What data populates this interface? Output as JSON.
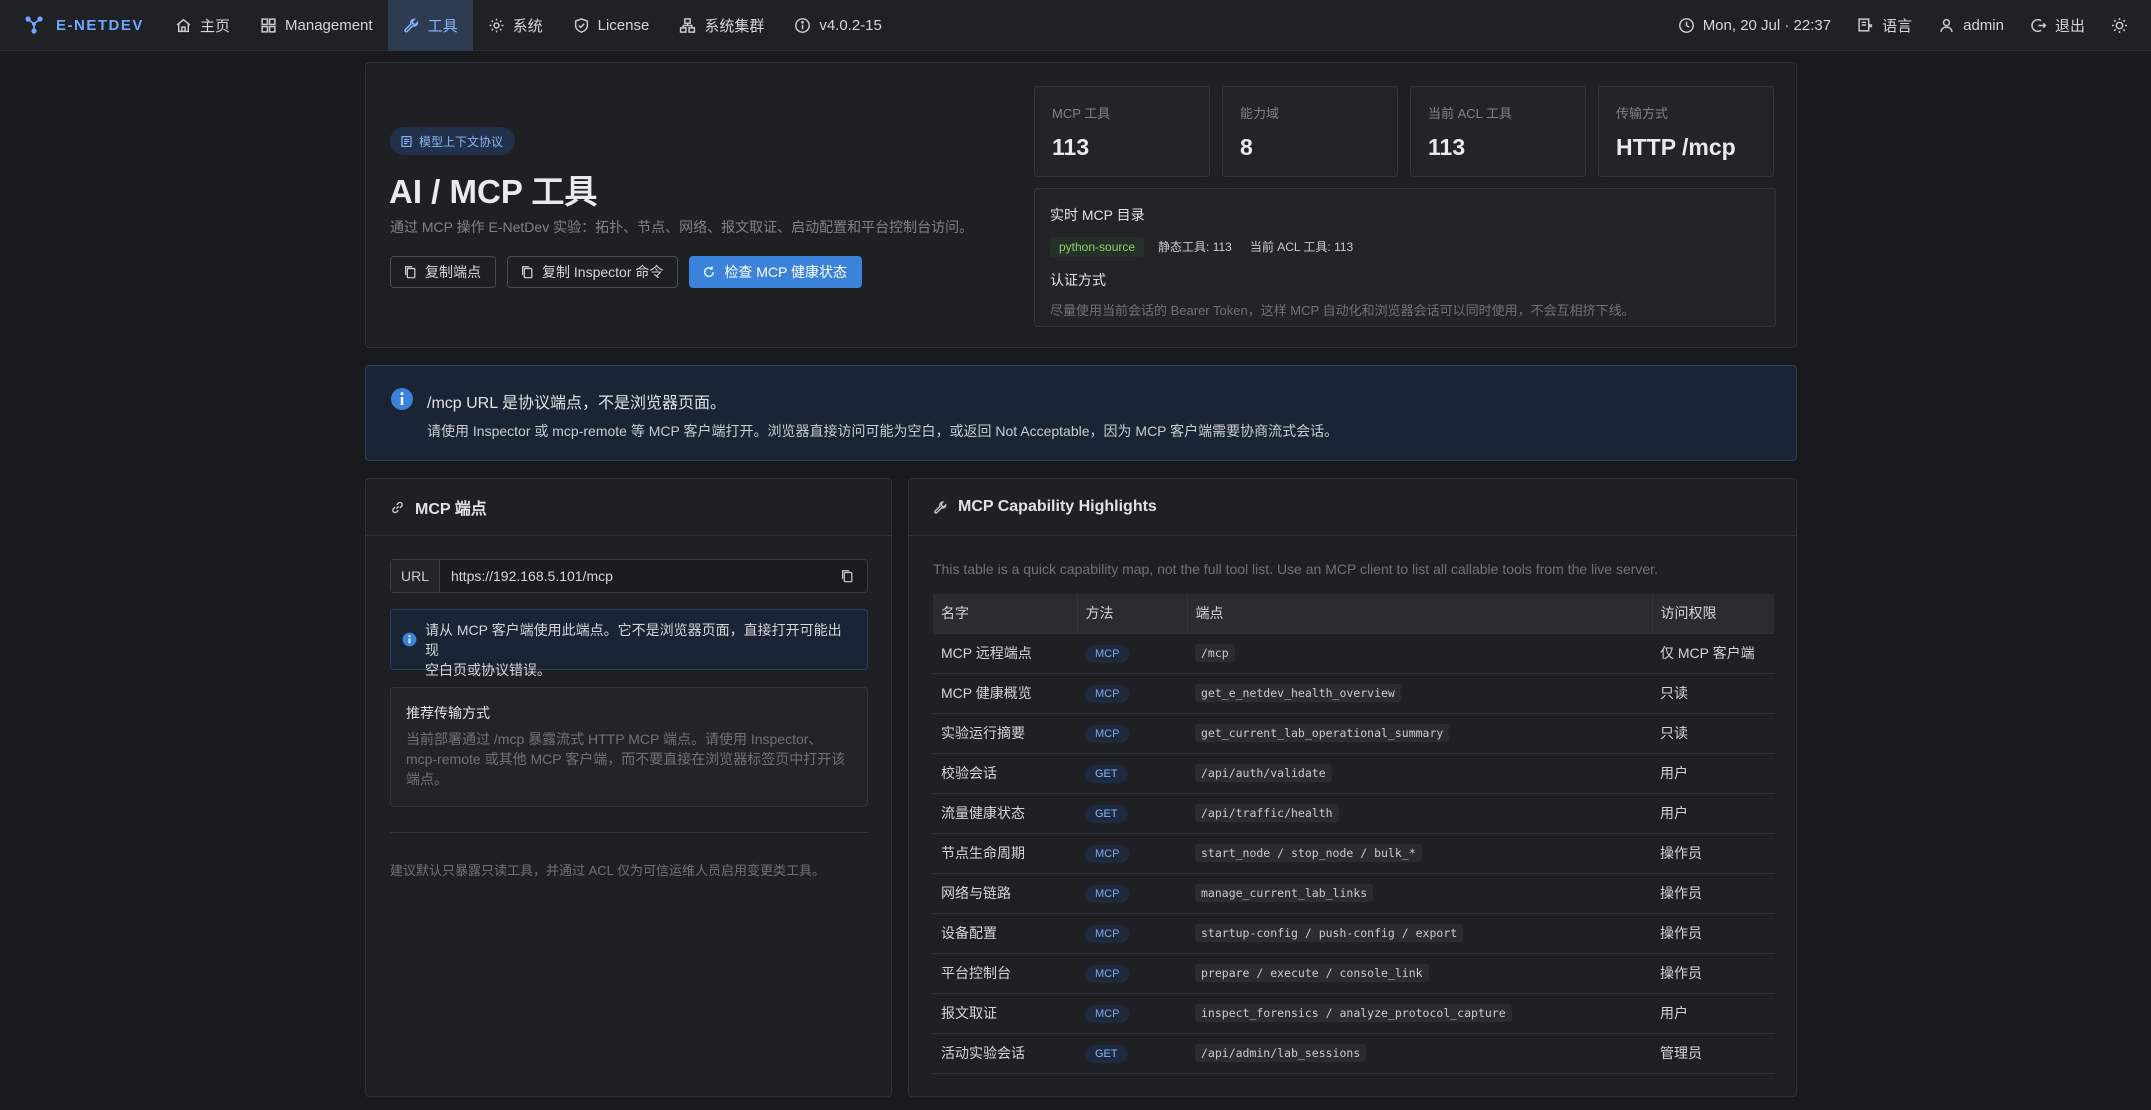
{
  "brand": "E-NETDEV",
  "nav": [
    {
      "label": "主页",
      "icon": "home-icon"
    },
    {
      "label": "Management",
      "icon": "grid-icon"
    },
    {
      "label": "工具",
      "icon": "wrench-icon",
      "active": true
    },
    {
      "label": "系统",
      "icon": "gear-icon"
    },
    {
      "label": "License",
      "icon": "shield-icon"
    },
    {
      "label": "系统集群",
      "icon": "cluster-icon"
    },
    {
      "label": "v4.0.2-15",
      "icon": "info-icon"
    }
  ],
  "nav_right": {
    "datetime": "Mon, 20 Jul · 22:37",
    "language": "语言",
    "user": "admin",
    "logout": "退出"
  },
  "hero": {
    "pill": "模型上下文协议",
    "title": "AI / MCP 工具",
    "subtitle": "通过 MCP 操作 E-NetDev 实验：拓扑、节点、网络、报文取证、启动配置和平台控制台访问。",
    "buttons": {
      "copy_endpoint": "复制端点",
      "copy_inspector": "复制 Inspector 命令",
      "check_health": "检查 MCP 健康状态"
    },
    "stats": [
      {
        "label": "MCP 工具",
        "value": "113"
      },
      {
        "label": "能力域",
        "value": "8"
      },
      {
        "label": "当前 ACL 工具",
        "value": "113"
      },
      {
        "label": "传输方式",
        "value": "HTTP /mcp"
      }
    ],
    "catalog": {
      "title": "实时 MCP 目录",
      "source_tag": "python-source",
      "static_tools": "静态工具: 113",
      "acl_tools": "当前 ACL 工具: 113",
      "auth_title": "认证方式",
      "auth_desc": "尽量使用当前会话的 Bearer Token，这样 MCP 自动化和浏览器会话可以同时使用，不会互相挤下线。"
    }
  },
  "banner": {
    "title": "/mcp URL 是协议端点，不是浏览器页面。",
    "text": "请使用 Inspector 或 mcp-remote 等 MCP 客户端打开。浏览器直接访问可能为空白，或返回 Not Acceptable，因为 MCP 客户端需要协商流式会话。"
  },
  "endpoint_panel": {
    "title": "MCP 端点",
    "url_label": "URL",
    "url_value": "https://192.168.5.101/mcp",
    "alert_line1": "请从 MCP 客户端使用此端点。它不是浏览器页面，直接打开可能出现",
    "alert_line2": "空白页或协议错误。",
    "rec_title": "推荐传输方式",
    "rec_line1": "当前部署通过 /mcp 暴露流式 HTTP MCP 端点。请使用 Inspector、",
    "rec_line2": "mcp-remote 或其他 MCP 客户端，而不要直接在浏览器标签页中打开该",
    "rec_line3": "端点。",
    "note": "建议默认只暴露只读工具，并通过 ACL 仅为可信运维人员启用变更类工具。"
  },
  "capability_panel": {
    "title": "MCP Capability Highlights",
    "description": "This table is a quick capability map, not the full tool list. Use an MCP client to list all callable tools from the live server.",
    "headers": [
      "名字",
      "方法",
      "端点",
      "访问权限"
    ],
    "rows": [
      {
        "name": "MCP 远程端点",
        "method": "MCP",
        "endpoint": "/mcp",
        "access": "仅 MCP 客户端"
      },
      {
        "name": "MCP 健康概览",
        "method": "MCP",
        "endpoint": "get_e_netdev_health_overview",
        "access": "只读"
      },
      {
        "name": "实验运行摘要",
        "method": "MCP",
        "endpoint": "get_current_lab_operational_summary",
        "access": "只读"
      },
      {
        "name": "校验会话",
        "method": "GET",
        "endpoint": "/api/auth/validate",
        "access": "用户"
      },
      {
        "name": "流量健康状态",
        "method": "GET",
        "endpoint": "/api/traffic/health",
        "access": "用户"
      },
      {
        "name": "节点生命周期",
        "method": "MCP",
        "endpoint": "start_node / stop_node / bulk_*",
        "access": "操作员"
      },
      {
        "name": "网络与链路",
        "method": "MCP",
        "endpoint": "manage_current_lab_links",
        "access": "操作员"
      },
      {
        "name": "设备配置",
        "method": "MCP",
        "endpoint": "startup-config / push-config / export",
        "access": "操作员"
      },
      {
        "name": "平台控制台",
        "method": "MCP",
        "endpoint": "prepare / execute / console_link",
        "access": "操作员"
      },
      {
        "name": "报文取证",
        "method": "MCP",
        "endpoint": "inspect_forensics / analyze_protocol_capture",
        "access": "用户"
      },
      {
        "name": "活动实验会话",
        "method": "GET",
        "endpoint": "/api/admin/lab_sessions",
        "access": "管理员"
      }
    ]
  },
  "colors": {
    "accent": "#3b82db",
    "brand": "#6ea8fe",
    "background": "#191a1d",
    "panel": "#1f2023",
    "info_bg": "#1b2434",
    "tag_green": "#8fcf6f"
  }
}
